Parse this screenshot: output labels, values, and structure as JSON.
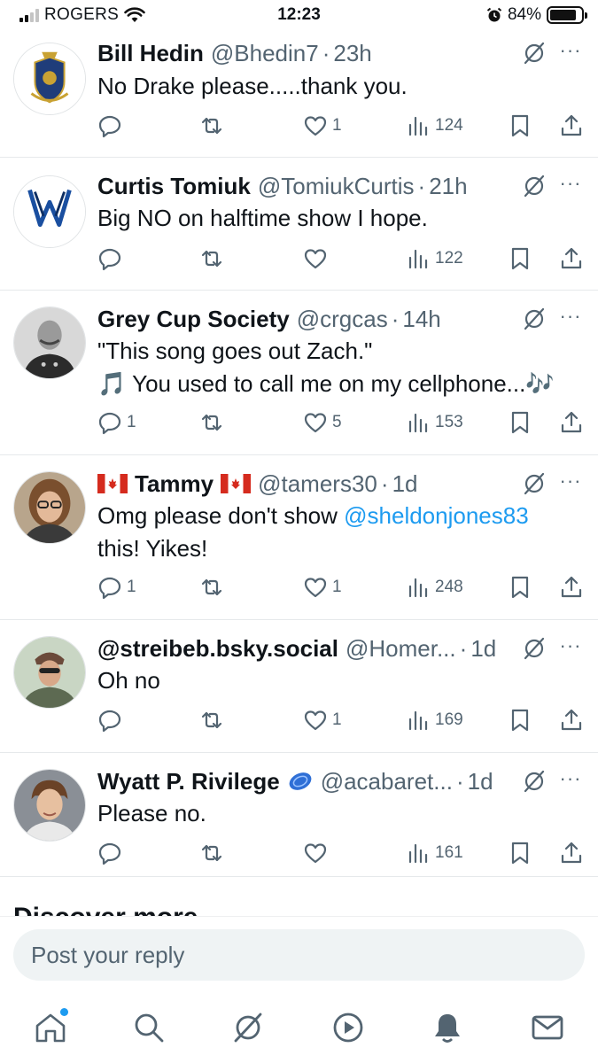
{
  "status_bar": {
    "carrier": "ROGERS",
    "time": "12:23",
    "battery_percent": "84%",
    "battery_level": 0.84,
    "icons": [
      "signal-icon",
      "wifi-icon",
      "alarm-icon",
      "battery-icon"
    ]
  },
  "replies": [
    {
      "name": "Bill Hedin",
      "handle": "@Bhedin7",
      "separator": "·",
      "time": "23h",
      "text": "No Drake please.....thank you.",
      "reply_count": "",
      "like_count": "1",
      "view_count": "124",
      "liked": false
    },
    {
      "name": "Curtis Tomiuk",
      "handle": "@TomiukCurtis",
      "separator": "·",
      "time": "21h",
      "text": "Big NO on halftime show I hope.",
      "reply_count": "",
      "like_count": "",
      "view_count": "122"
    },
    {
      "name": "Grey Cup Society",
      "handle": "@crgcas",
      "separator": "·",
      "time": "14h",
      "text_line1": "\"This song goes out Zach.\"",
      "text_line2": "🎵 You used to call me on my cellphone...🎶",
      "reply_count": "1",
      "like_count": "5",
      "view_count": "153"
    },
    {
      "name": "Tammy",
      "handle": "@tamers30",
      "separator": "·",
      "time": "1d",
      "text_pre": "Omg please don't show ",
      "mention": "@sheldonjones83",
      "text_post": "this! Yikes!",
      "reply_count": "1",
      "like_count": "1",
      "view_count": "248"
    },
    {
      "name": "@streibeb.bsky.social",
      "handle": "@Homer...",
      "separator": "·",
      "time": "1d",
      "text": "Oh no",
      "reply_count": "",
      "like_count": "1",
      "view_count": "169"
    },
    {
      "name": "Wyatt P. Rivilege",
      "handle": "@acabaret...",
      "separator": "·",
      "time": "1d",
      "text": "Please no.",
      "reply_count": "",
      "like_count": "",
      "view_count": "161"
    }
  ],
  "more_label": "···",
  "discover_heading": "Discover more",
  "compose": {
    "placeholder": "Post your reply"
  },
  "nav": [
    "home-icon",
    "search-icon",
    "grok-icon",
    "video-icon",
    "notifications-icon",
    "messages-icon"
  ],
  "colors": {
    "accent": "#1d9bf0",
    "secondary_text": "#536471",
    "divider": "#e6e9eb"
  }
}
